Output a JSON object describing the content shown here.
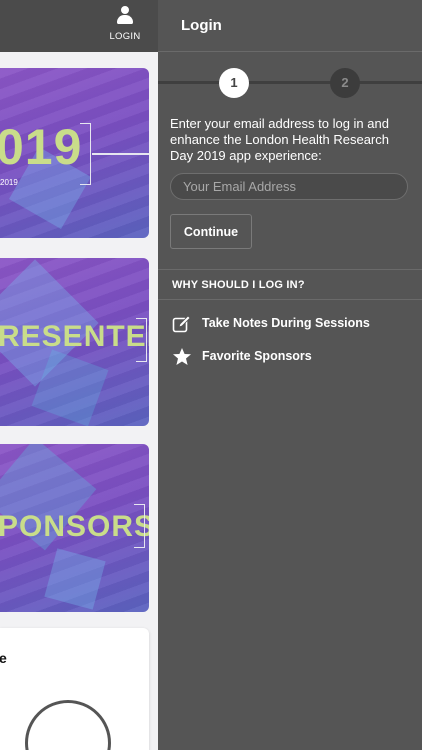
{
  "topbar": {
    "login_label": "LOGIN"
  },
  "cards": [
    {
      "big_text": "019",
      "sub_text": "2019"
    },
    {
      "big_text": "RESENTERS"
    },
    {
      "big_text": "PONSORS"
    },
    {
      "partial_text": "e"
    }
  ],
  "panel": {
    "title": "Login",
    "steps": [
      "1",
      "2"
    ],
    "active_step": 1,
    "intro": "Enter your email address to log in and enhance the London Health Research Day 2019 app experience:",
    "email_placeholder": "Your Email Address",
    "email_value": "",
    "continue_label": "Continue",
    "why_heading": "WHY SHOULD I LOG IN?",
    "benefits": [
      {
        "icon": "edit-icon",
        "label": "Take Notes During Sessions"
      },
      {
        "icon": "star-icon",
        "label": "Favorite Sponsors"
      }
    ]
  },
  "colors": {
    "panel_bg": "#555555",
    "topbar_bg": "#4b4b4b",
    "card_gradient_start": "#8b56c6",
    "card_gradient_end": "#5b63c0",
    "card_text_accent": "#c9dd8a"
  }
}
